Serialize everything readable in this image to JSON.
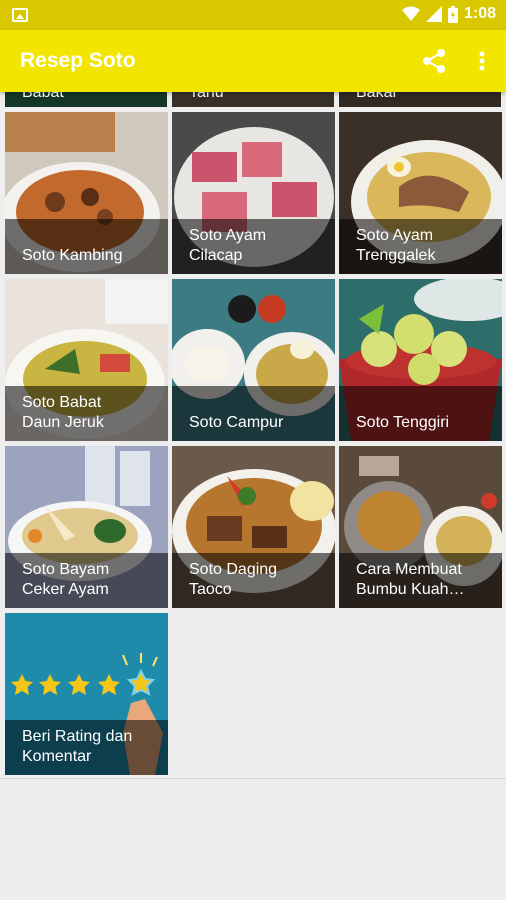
{
  "status_bar": {
    "time": "1:08"
  },
  "app_bar": {
    "title": "Resep Soto"
  },
  "partial_row": [
    {
      "label": "Babat"
    },
    {
      "label": "Tahu"
    },
    {
      "label": "Bakar"
    }
  ],
  "recipes": [
    {
      "label": "Soto Kambing"
    },
    {
      "label": "Soto Ayam\nCilacap"
    },
    {
      "label": "Soto Ayam\nTrenggalek"
    },
    {
      "label": "Soto Babat\nDaun Jeruk"
    },
    {
      "label": "Soto Campur"
    },
    {
      "label": "Soto Tenggiri"
    },
    {
      "label": "Soto Bayam\nCeker Ayam"
    },
    {
      "label": "Soto Daging\nTaoco"
    },
    {
      "label": "Cara Membuat\nBumbu Kuah…"
    },
    {
      "label": "Beri Rating dan\nKomentar"
    }
  ],
  "colors": {
    "status_bar": "#d9c800",
    "app_bar": "#f2e600",
    "rating_bg": "#1e8bab",
    "star": "#f5c518"
  }
}
